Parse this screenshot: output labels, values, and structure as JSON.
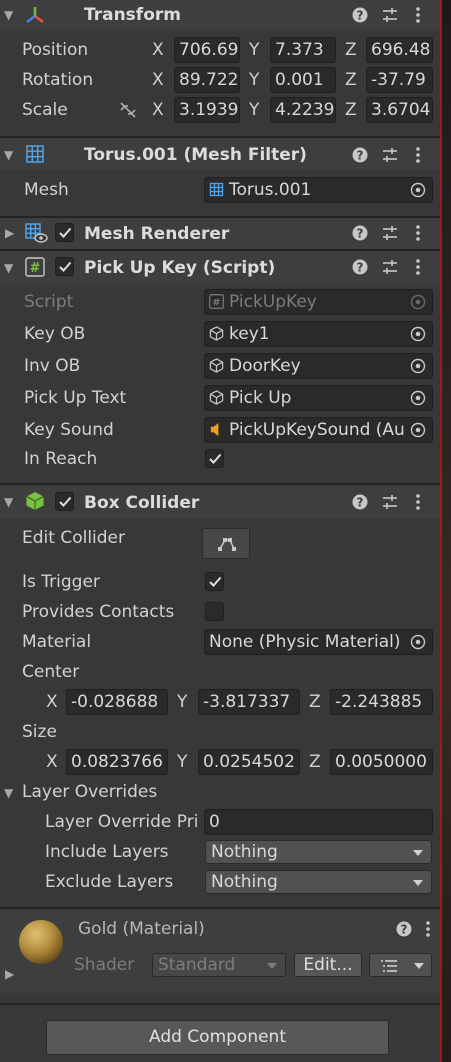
{
  "transform": {
    "title": "Transform",
    "position_label": "Position",
    "rotation_label": "Rotation",
    "scale_label": "Scale",
    "position": {
      "x": "706.69",
      "y": "7.373",
      "z": "696.48"
    },
    "rotation": {
      "x": "89.722",
      "y": "0.001",
      "z": "-37.79"
    },
    "scale": {
      "x": "3.1939",
      "y": "4.2239",
      "z": "3.6704"
    }
  },
  "axes": {
    "x": "X",
    "y": "Y",
    "z": "Z"
  },
  "mesh_filter": {
    "title": "Torus.001 (Mesh Filter)",
    "mesh_label": "Mesh",
    "mesh_value": "Torus.001"
  },
  "mesh_renderer": {
    "title": "Mesh Renderer"
  },
  "pickup_script": {
    "title": "Pick Up Key (Script)",
    "script_label": "Script",
    "script_value": "PickUpKey",
    "key_ob_label": "Key OB",
    "key_ob_value": "key1",
    "inv_ob_label": "Inv OB",
    "inv_ob_value": "DoorKey",
    "pickup_text_label": "Pick Up Text",
    "pickup_text_value": "Pick Up",
    "key_sound_label": "Key Sound",
    "key_sound_value": "PickUpKeySound (Au",
    "in_reach_label": "In Reach"
  },
  "box_collider": {
    "title": "Box Collider",
    "edit_collider_label": "Edit Collider",
    "is_trigger_label": "Is Trigger",
    "provides_contacts_label": "Provides Contacts",
    "material_label": "Material",
    "material_value": "None (Physic Material)",
    "center_label": "Center",
    "center": {
      "x": "-0.028688",
      "y": "-3.817337",
      "z": "-2.243885"
    },
    "size_label": "Size",
    "size": {
      "x": "0.0823766",
      "y": "0.0254502",
      "z": "0.0050000"
    },
    "layer_overrides_label": "Layer Overrides",
    "layer_override_priority_label": "Layer Override Pri",
    "layer_override_priority_value": "0",
    "include_layers_label": "Include Layers",
    "include_layers_value": "Nothing",
    "exclude_layers_label": "Exclude Layers",
    "exclude_layers_value": "Nothing"
  },
  "material": {
    "title": "Gold (Material)",
    "shader_label": "Shader",
    "shader_value": "Standard",
    "edit_label": "Edit..."
  },
  "add_component_label": "Add Component",
  "colors": {
    "background": "#383838",
    "header": "#3e3e3e",
    "field": "#2a2a2a",
    "accent_red": "#a01818",
    "gold": "#b8943e"
  }
}
